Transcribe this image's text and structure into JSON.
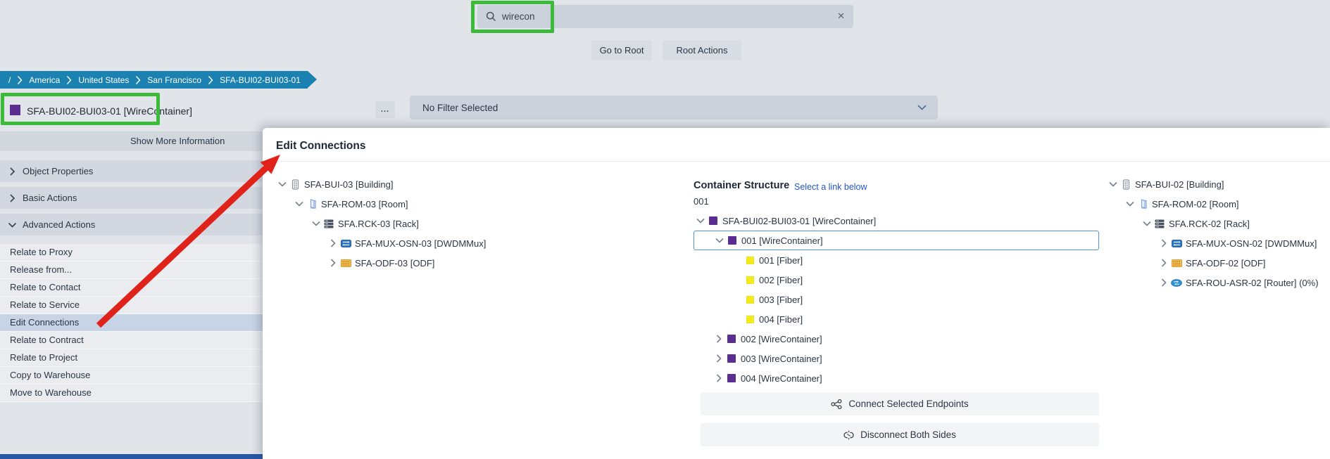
{
  "topbar": {
    "search_value": "wirecon",
    "clear_label": "✕",
    "go_to_root": "Go to Root",
    "root_actions": "Root Actions"
  },
  "breadcrumb": {
    "items": [
      "/",
      "America",
      "United States",
      "San Francisco",
      "SFA-BUI02-BUI03-01"
    ]
  },
  "object_panel": {
    "title": "SFA-BUI02-BUI03-01 [WireContainer]",
    "title_icon": "wirecontainer",
    "more_label": "...",
    "show_more": "Show More Information",
    "filter_value": "No Filter Selected"
  },
  "sidebar": {
    "sections": [
      {
        "label": "Object Properties",
        "expanded": false
      },
      {
        "label": "Basic Actions",
        "expanded": false
      },
      {
        "label": "Advanced Actions",
        "expanded": true
      }
    ],
    "actions": [
      "Relate to Proxy",
      "Release from...",
      "Relate to Contact",
      "Relate to Service",
      "Edit Connections",
      "Relate to Contract",
      "Relate to Project",
      "Copy to Warehouse",
      "Move to Warehouse"
    ],
    "selected_action": "Edit Connections"
  },
  "dialog": {
    "title": "Edit Connections",
    "left_tree": [
      {
        "level": 0,
        "chevron": "expanded",
        "icon": "building",
        "label": "SFA-BUI-03 [Building]"
      },
      {
        "level": 1,
        "chevron": "expanded",
        "icon": "room",
        "label": "SFA-ROM-03 [Room]"
      },
      {
        "level": 2,
        "chevron": "expanded",
        "icon": "rack",
        "label": "SFA.RCK-03 [Rack]"
      },
      {
        "level": 3,
        "chevron": "collapsed",
        "icon": "dwdmmux",
        "label": "SFA-MUX-OSN-03 [DWDMMux]"
      },
      {
        "level": 3,
        "chevron": "collapsed",
        "icon": "odf",
        "label": "SFA-ODF-03 [ODF]"
      }
    ],
    "container_structure": {
      "heading": "Container Structure",
      "hint": "Select a link below",
      "selected_wire": "001",
      "tree": [
        {
          "level": 0,
          "chevron": "expanded",
          "icon": "wirecontainer",
          "label": "SFA-BUI02-BUI03-01 [WireContainer]"
        },
        {
          "level": 1,
          "chevron": "expanded",
          "icon": "wirecontainer",
          "label": "001 [WireContainer]",
          "selected": true
        },
        {
          "level": 2,
          "chevron": null,
          "icon": "fiber",
          "label": "001 [Fiber]"
        },
        {
          "level": 2,
          "chevron": null,
          "icon": "fiber",
          "label": "002 [Fiber]"
        },
        {
          "level": 2,
          "chevron": null,
          "icon": "fiber",
          "label": "003 [Fiber]"
        },
        {
          "level": 2,
          "chevron": null,
          "icon": "fiber",
          "label": "004 [Fiber]"
        },
        {
          "level": 1,
          "chevron": "collapsed",
          "icon": "wirecontainer",
          "label": "002 [WireContainer]"
        },
        {
          "level": 1,
          "chevron": "collapsed",
          "icon": "wirecontainer",
          "label": "003 [WireContainer]"
        },
        {
          "level": 1,
          "chevron": "collapsed",
          "icon": "wirecontainer",
          "label": "004 [WireContainer]"
        }
      ]
    },
    "buttons": [
      {
        "icon": "share",
        "label": "Connect Selected Endpoints"
      },
      {
        "icon": "disconnect",
        "label": "Disconnect Both Sides"
      }
    ],
    "right_tree": [
      {
        "level": 0,
        "chevron": "expanded",
        "icon": "building",
        "label": "SFA-BUI-02 [Building]"
      },
      {
        "level": 1,
        "chevron": "expanded",
        "icon": "room",
        "label": "SFA-ROM-02 [Room]"
      },
      {
        "level": 2,
        "chevron": "expanded",
        "icon": "rack",
        "label": "SFA.RCK-02 [Rack]"
      },
      {
        "level": 3,
        "chevron": "collapsed",
        "icon": "dwdmmux",
        "label": "SFA-MUX-OSN-02 [DWDMMux]"
      },
      {
        "level": 3,
        "chevron": "collapsed",
        "icon": "odf",
        "label": "SFA-ODF-02 [ODF]"
      },
      {
        "level": 3,
        "chevron": "collapsed",
        "icon": "router",
        "label": "SFA-ROU-ASR-02 [Router] (0%)"
      }
    ]
  },
  "annotations": {
    "highlight_color": "#3cba3a",
    "arrow_color": "#e0231a"
  }
}
